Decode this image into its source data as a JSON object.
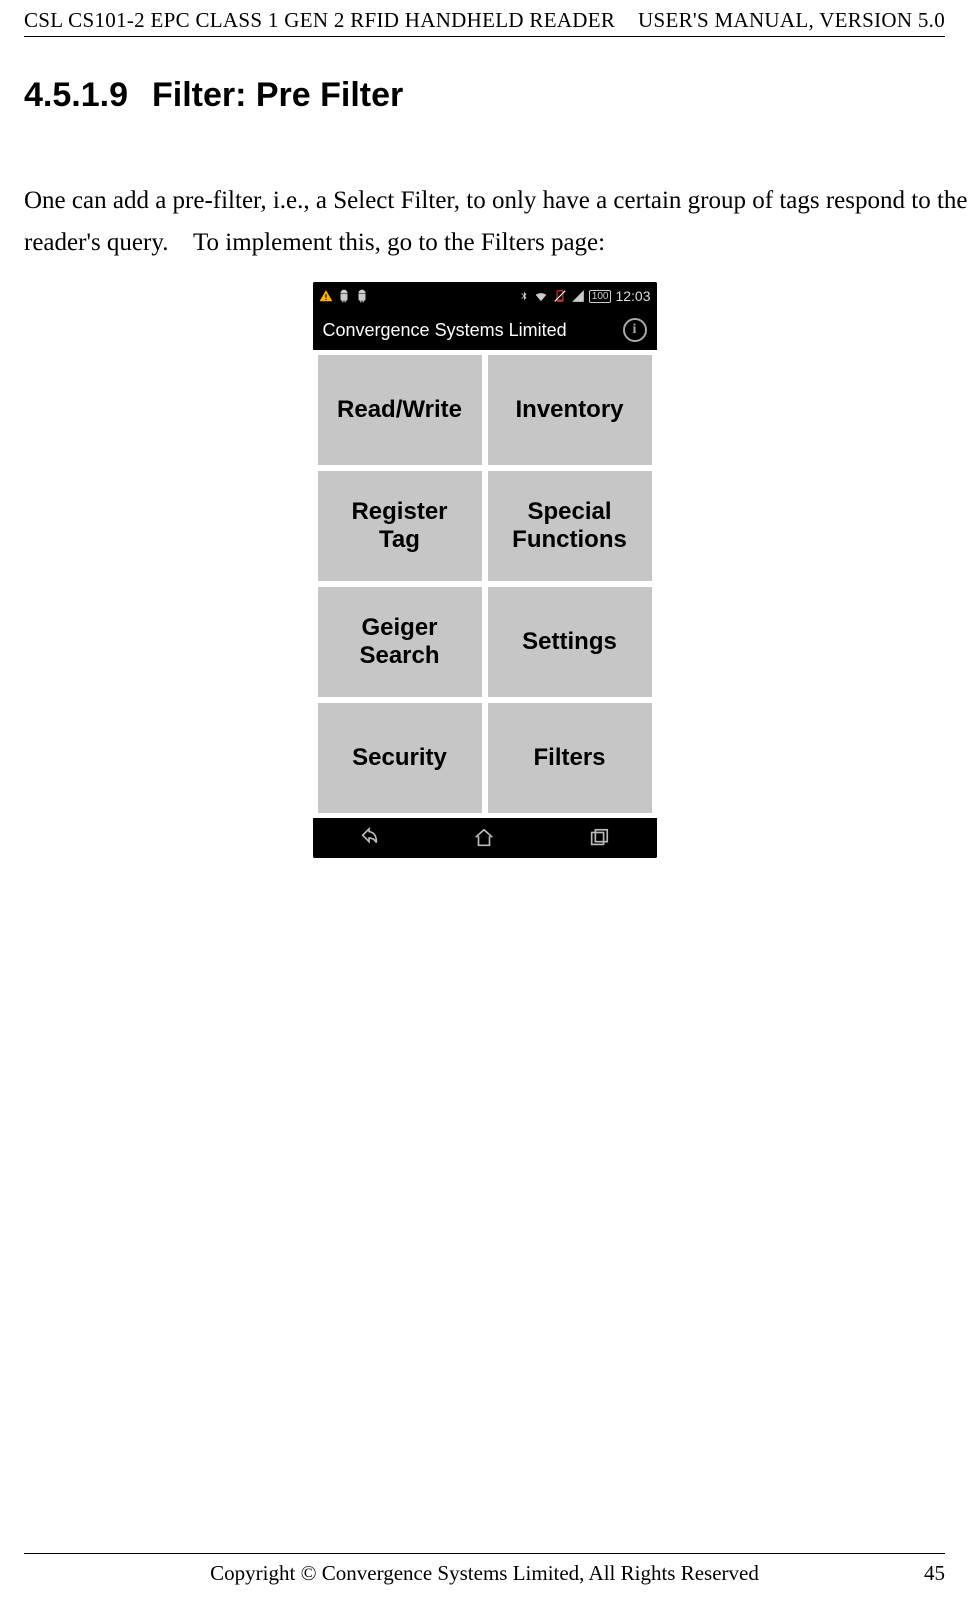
{
  "docHeader": {
    "left": "CSL CS101-2 EPC CLASS 1 GEN 2 RFID HANDHELD READER",
    "right": "USER'S  MANUAL,  VERSION  5.0"
  },
  "section": {
    "number": "4.5.1.9",
    "title": "Filter: Pre Filter"
  },
  "paragraph": {
    "line1": "One can add a pre-filter, i.e., a Select Filter, to only have a certain group of tags respond to the",
    "line2": "reader's query.    To implement this, go to the Filters page:"
  },
  "screenshot": {
    "statusBar": {
      "leftIcons": [
        "warning-icon",
        "android-icon",
        "android-icon"
      ],
      "rightIcons": [
        "bluetooth-icon",
        "wifi-icon",
        "phone-off-icon",
        "signal-icon"
      ],
      "battery": "100",
      "time": "12:03"
    },
    "appBar": {
      "title": "Convergence Systems Limited",
      "rightIcon": "info-icon"
    },
    "tiles": [
      "Read/Write",
      "Inventory",
      "Register\nTag",
      "Special\nFunctions",
      "Geiger\nSearch",
      "Settings",
      "Security",
      "Filters"
    ],
    "navBar": [
      "back-icon",
      "home-icon",
      "recent-icon"
    ]
  },
  "docFooter": {
    "center": "Copyright © Convergence Systems Limited, All Rights Reserved",
    "page": "45"
  }
}
